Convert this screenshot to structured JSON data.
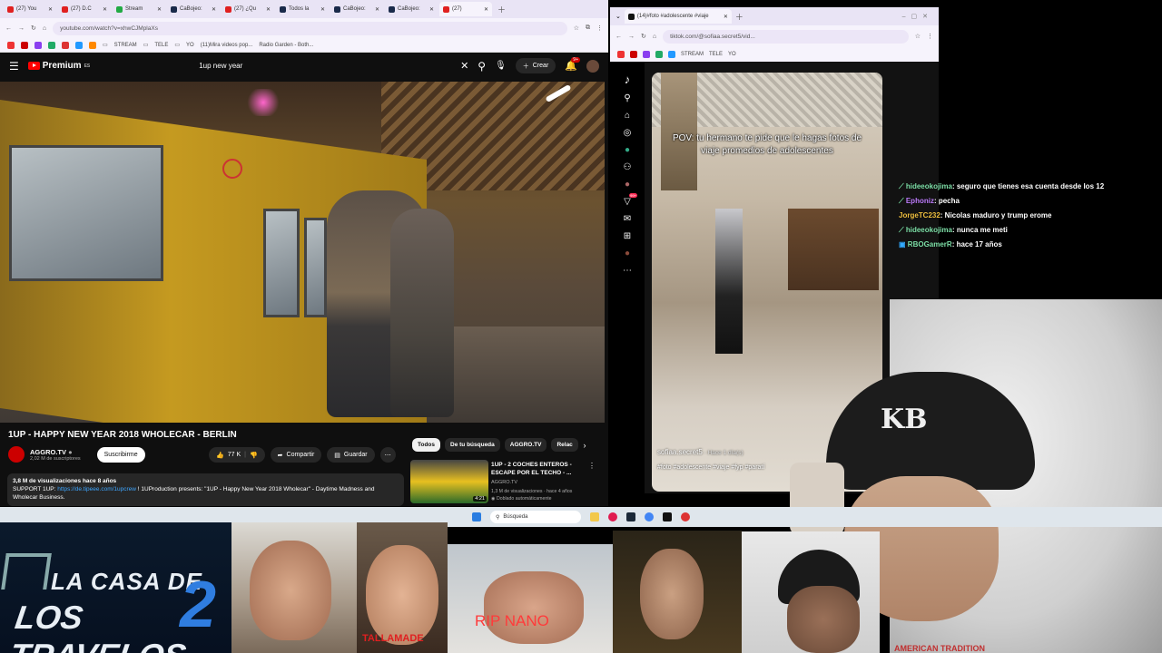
{
  "left_browser": {
    "tabs": [
      {
        "label": "(27) You",
        "color": "#e02020"
      },
      {
        "label": "(27) D.C",
        "color": "#e02020"
      },
      {
        "label": "Stream",
        "color": "#22aa44"
      },
      {
        "label": "CaBojeo:",
        "color": "#1a2a4a"
      },
      {
        "label": "(27) ¿Qu",
        "color": "#e02020"
      },
      {
        "label": "Todos la",
        "color": "#1a2a4a"
      },
      {
        "label": "CaBojeo:",
        "color": "#1a2a4a"
      },
      {
        "label": "CaBojeo:",
        "color": "#1a2a4a"
      },
      {
        "label": "(27)",
        "color": "#e02020"
      }
    ],
    "url": "youtube.com/watch?v=xhwCJMplaXs",
    "bookmarks": [
      "STREAM",
      "TELE",
      "YO",
      "(11)Mira videos pop...",
      "Radio Garden - Both..."
    ]
  },
  "youtube": {
    "logo": "Premium",
    "logo_sup": "ES",
    "search_query": "1up new year",
    "create_label": "Crear",
    "notif_count": "9+",
    "video_title": "1UP - HAPPY NEW YEAR 2018 WHOLECAR - BERLIN",
    "channel": "AGGRO.TV",
    "subscribers": "2,02 M de suscriptores",
    "subscribe_label": "Suscribirme",
    "likes": "77 K",
    "share_label": "Compartir",
    "save_label": "Guardar",
    "views_line": "3,8 M de visualizaciones  hace 8 años",
    "desc_prefix": "SUPPORT 1UP:",
    "desc_link": "https://de.tipeee.com/1upcrew",
    "desc_rest": " ! 1UProduction presents: \"1UP - Happy New Year 2018 Wholecar\" - Daytime Madness and Wholecar Business.",
    "chips": [
      "Todos",
      "De tu búsqueda",
      "AGGRO.TV",
      "Relac"
    ],
    "rec": {
      "title": "1UP - 2 COCHES ENTEROS - ESCAPE POR EL TECHO - ...",
      "channel": "AGGRO.TV",
      "meta": "1,3 M de visualizaciones · hace 4 años",
      "dub": "Doblado automáticamente",
      "duration": "4:21"
    }
  },
  "right_browser": {
    "tab": "(14)#foto #adolescente #viaje",
    "url": "tiktok.com/@sofiaa.secret5/vid...",
    "bookmarks": [
      "STREAM",
      "TELE",
      "YO"
    ]
  },
  "tiktok": {
    "caption": "POV: tu hermano te pide que le hagas fotos de viaje promedios de adolescentes",
    "user": "sofiaa.secret5",
    "time": " · Hace 1 día(s)",
    "tags": "#foto #adolescente #viaje #fyp #paratí",
    "badge": "99+"
  },
  "chat": [
    {
      "user": "hideeokojima",
      "msg": ": seguro que tienes esa cuenta desde los 12",
      "color": "#7ee0a8"
    },
    {
      "user": "Ephoniz",
      "msg": ": pecha",
      "color": "#c07fff"
    },
    {
      "user": "JorgeTC232",
      "msg": ": Nicolas maduro y trump erome",
      "color": "#f0c040"
    },
    {
      "user": "hideeokojima",
      "msg": ": nunca me meti",
      "color": "#7ee0a8"
    },
    {
      "user": "RBOGamerR",
      "msg": ": hace 17 años",
      "color": "#7ee0a8"
    }
  ],
  "taskbar": {
    "search": "Búsqueda"
  },
  "overlay": {
    "show_line1": "LA CASA DE",
    "show_line2": "LOS TRAVELOS",
    "show_num": "2",
    "tallamade": "TALLAMADE",
    "rip": "RIP NANO",
    "american": "AMERICAN TRADITION"
  }
}
